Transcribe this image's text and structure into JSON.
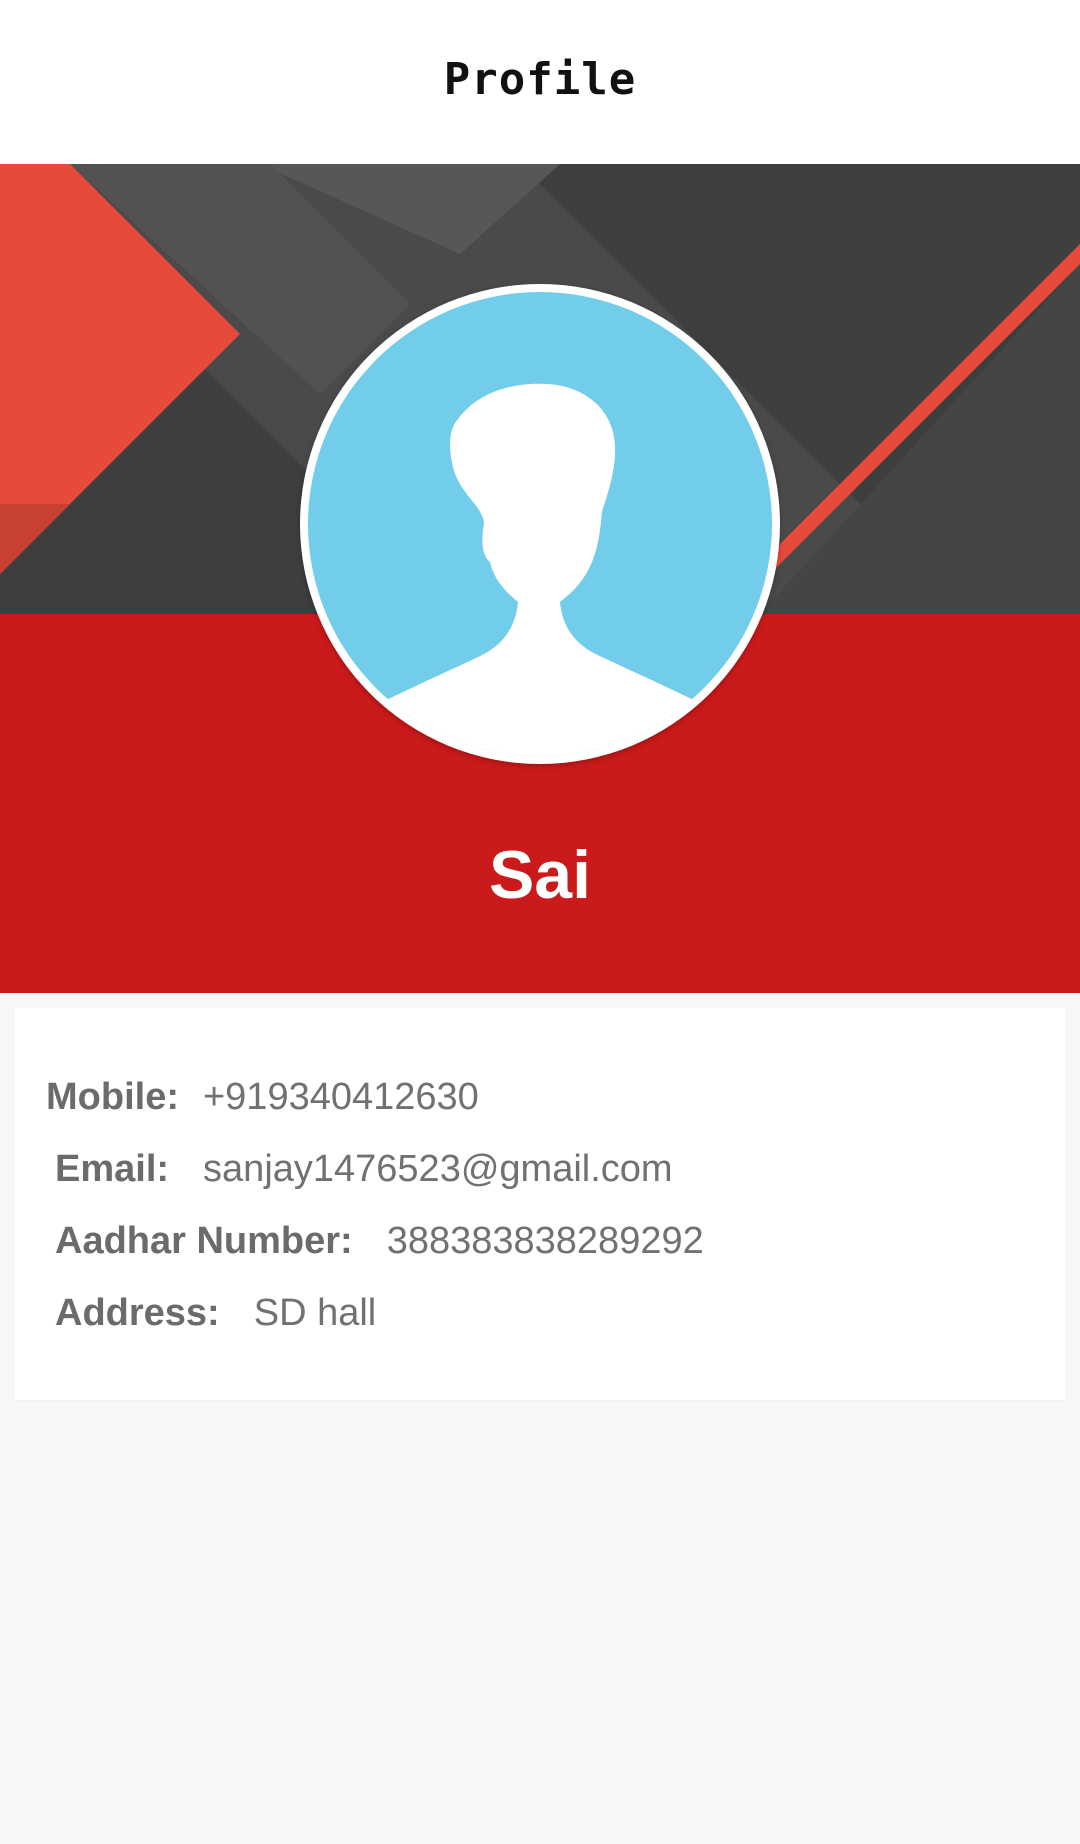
{
  "app_bar": {
    "title": "Profile"
  },
  "profile": {
    "name": "Sai",
    "avatar_icon": "default-user-silhouette-icon"
  },
  "details": {
    "mobile": {
      "label": "Mobile:",
      "value": "+919340412630"
    },
    "email": {
      "label": "Email:",
      "value": "sanjay1476523@gmail.com"
    },
    "aadhar": {
      "label": "Aadhar Number:",
      "value": "388383838289292"
    },
    "address": {
      "label": "Address:",
      "value": "SD hall"
    }
  },
  "colors": {
    "header_red": "#cb1a1b",
    "banner_dark": "#3e3e3e",
    "accent_red": "#e74c3c",
    "avatar_blue": "#72cdeb",
    "page_background": "#f8f8f8"
  }
}
